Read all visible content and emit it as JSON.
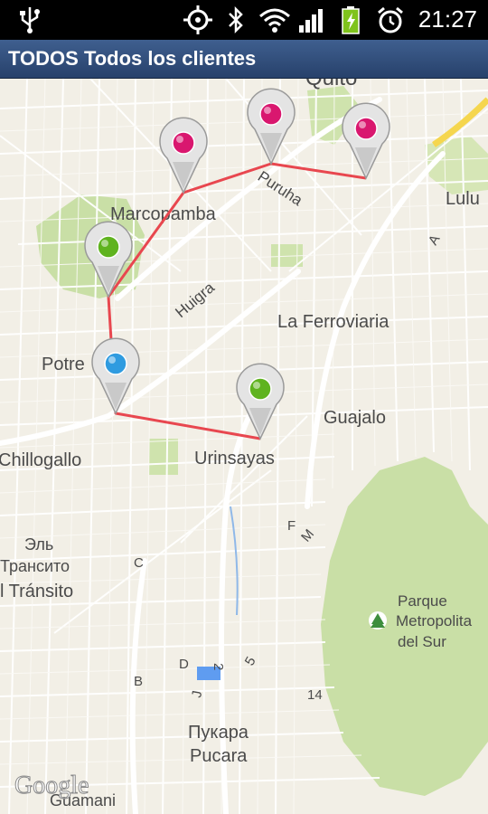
{
  "status_bar": {
    "time": "21:27",
    "icons": [
      "usb-icon",
      "gps-icon",
      "bluetooth-icon",
      "wifi-icon",
      "signal-icon",
      "battery-charging-icon",
      "alarm-icon"
    ]
  },
  "title_bar": {
    "title": "TODOS Todos los clientes"
  },
  "map": {
    "labels": {
      "quito": "Quito",
      "marcopamba": "Marcopamba",
      "lulu": "Lulu",
      "puruha": "Puruha",
      "huigra": "Huigra",
      "la_ferroviaria": "La Ferroviaria",
      "potrero": "Potre",
      "guajalo": "Guajalo",
      "chillogallo": "Chillogallo",
      "urinsayas": "Urinsayas",
      "el_latin": "Эль",
      "transito_ru": "Трансито",
      "el_transito": "l Tránsito",
      "parque_1": "Parque",
      "parque_2": "Metropolita",
      "parque_3": "del Sur",
      "pukara_ru": "Пукара",
      "pucara": "Pucara",
      "guamani": "Guamani",
      "google": "Google",
      "road_a": "A",
      "road_f": "F",
      "road_m": "M",
      "road_c": "C",
      "road_b": "B",
      "road_d": "D",
      "road_2": "2",
      "road_5": "5",
      "road_14": "14",
      "road_j": "J"
    },
    "markers": [
      {
        "name": "marker-pink-1",
        "color": "#d9176f"
      },
      {
        "name": "marker-pink-2",
        "color": "#d9176f"
      },
      {
        "name": "marker-pink-3",
        "color": "#d9176f"
      },
      {
        "name": "marker-green-1",
        "color": "#5fb31f"
      },
      {
        "name": "marker-blue",
        "color": "#2f9be0"
      },
      {
        "name": "marker-green-2",
        "color": "#5fb31f"
      }
    ],
    "route_color": "#e8474f",
    "colors": {
      "land": "#f2efe6",
      "park": "#c9dfa6",
      "road": "#ffffff",
      "highway": "#f5d64e"
    }
  }
}
